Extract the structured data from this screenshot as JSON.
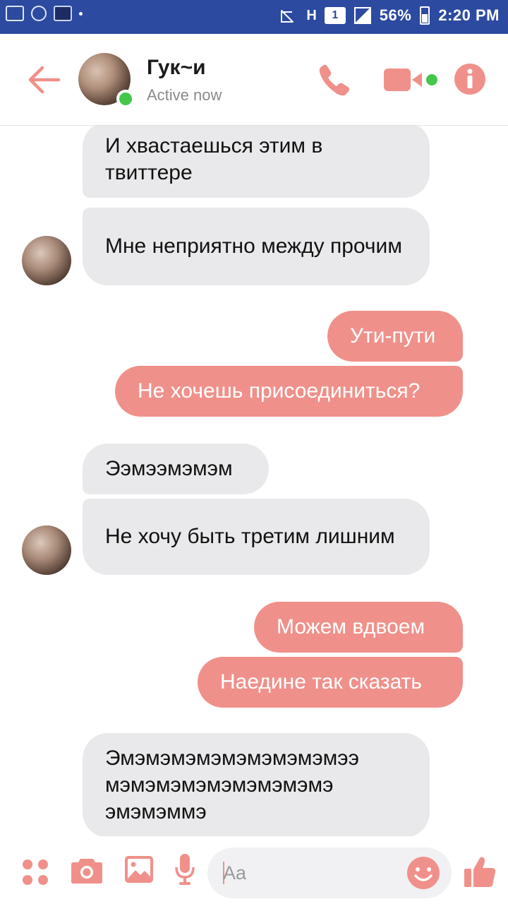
{
  "status_bar": {
    "network": "H",
    "sim_slot": "1",
    "battery": "56%",
    "time": "2:20 PM"
  },
  "header": {
    "contact_name": "Гук~и",
    "contact_status": "Active now"
  },
  "messages": [
    {
      "side": "incoming",
      "text": "И хвастаешься этим в твиттере"
    },
    {
      "side": "incoming",
      "text": "Мне неприятно между прочим"
    },
    {
      "side": "outgoing",
      "text": "Ути-пути"
    },
    {
      "side": "outgoing",
      "text": "Не хочешь присоединиться?"
    },
    {
      "side": "incoming",
      "text": "Ээмээмэмэм"
    },
    {
      "side": "incoming",
      "text": "Не хочу быть третим лишним"
    },
    {
      "side": "outgoing",
      "text": "Можем вдвоем"
    },
    {
      "side": "outgoing",
      "text": "Наедине так сказать"
    },
    {
      "side": "incoming",
      "text": "Эмэмэмэмэмэмэмэмэмээ мэмэмэмэмэмэмэмэмэ эмэмэммэ"
    }
  ],
  "composer": {
    "placeholder": "Aa",
    "value": ""
  },
  "colors": {
    "accent": "#f0908a",
    "incoming_bubble": "#e9e9eb",
    "online": "#44c64a",
    "status_bar": "#2c4aa0"
  },
  "icons": [
    "back-arrow-icon",
    "phone-icon",
    "video-camera-icon",
    "info-icon",
    "apps-grid-icon",
    "camera-icon",
    "gallery-icon",
    "microphone-icon",
    "emoji-icon",
    "thumbs-up-icon"
  ]
}
